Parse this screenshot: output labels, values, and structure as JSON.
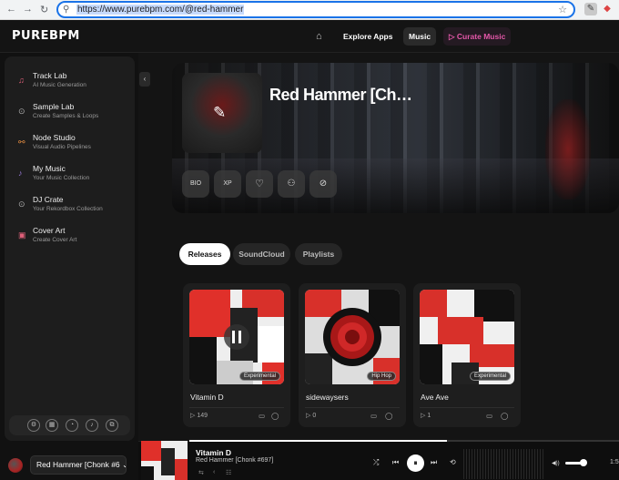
{
  "browser": {
    "url": "https://www.purebpm.com/@red-hammer",
    "back_icon": "←",
    "forward_icon": "→",
    "reload_icon": "↻"
  },
  "header": {
    "logo": "PUREBPM",
    "home_icon": "⌂",
    "nav": [
      {
        "label": "Explore Apps"
      },
      {
        "label": "Music"
      },
      {
        "label": "Curate Music",
        "icon": "▷"
      }
    ]
  },
  "sidebar": {
    "items": [
      {
        "title": "Track Lab",
        "subtitle": "AI Music Generation",
        "icon": "♫"
      },
      {
        "title": "Sample Lab",
        "subtitle": "Create Samples & Loops",
        "icon": "⊙"
      },
      {
        "title": "Node Studio",
        "subtitle": "Visual Audio Pipelines",
        "icon": "⚯"
      },
      {
        "title": "My Music",
        "subtitle": "Your Music Collection",
        "icon": "♪"
      },
      {
        "title": "DJ Crate",
        "subtitle": "Your Rekordbox Collection",
        "icon": "⊙"
      },
      {
        "title": "Cover Art",
        "subtitle": "Create Cover Art",
        "icon": "▣"
      }
    ],
    "tools": [
      "⚙",
      "▦",
      "◔",
      "♪",
      "⧉"
    ],
    "user_select": "Red Hammer [Chonk #6",
    "user_chevron": "⌄"
  },
  "profile": {
    "name": "Red Hammer [Ch…",
    "edit_icon": "✎",
    "buttons": [
      {
        "label": "BIO"
      },
      {
        "label": "XP"
      },
      {
        "label": "♡"
      },
      {
        "label": "⚇"
      },
      {
        "label": "⊘"
      }
    ]
  },
  "tabs": [
    {
      "label": "Releases",
      "active": true
    },
    {
      "label": "SoundCloud",
      "active": false
    },
    {
      "label": "Playlists",
      "active": false
    }
  ],
  "releases": [
    {
      "title": "Vitamin D",
      "genre": "Experimental",
      "plays": "149"
    },
    {
      "title": "sidewaysers",
      "genre": "Hip Hop",
      "plays": "0"
    },
    {
      "title": "Ave Ave",
      "genre": "Experimental",
      "plays": "1"
    }
  ],
  "player": {
    "title": "Vitamin D",
    "subtitle": "Red Hammer [Chonk #697]",
    "time": "1:5",
    "progress": 0.6,
    "volume": 0.7,
    "icons": {
      "shuffle": "⤮",
      "prev": "⏮",
      "play": "⏸",
      "next": "⏭",
      "repeat": "⟲",
      "volume": "◀))"
    }
  }
}
